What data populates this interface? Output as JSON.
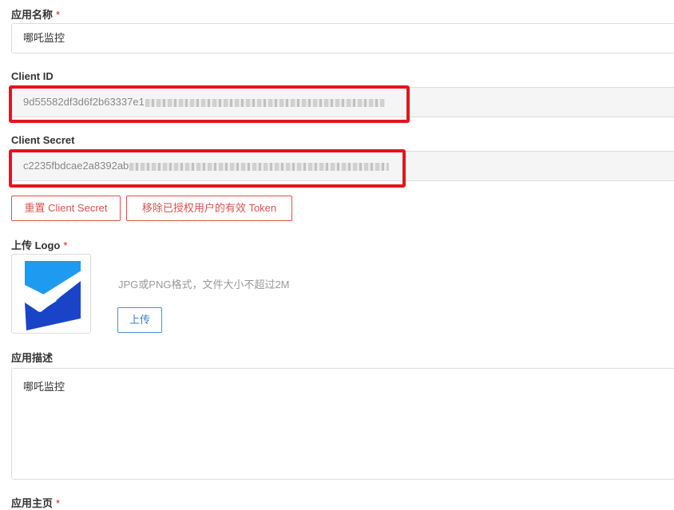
{
  "form": {
    "app_name": {
      "label": "应用名称",
      "required_mark": "*",
      "value": "哪吒监控"
    },
    "client_id": {
      "label": "Client ID",
      "visible_value": "9d55582df3d6f2b63337e1"
    },
    "client_secret": {
      "label": "Client Secret",
      "visible_value": "c2235fbdcae2a8392ab"
    },
    "buttons": {
      "reset_secret": "重置 Client Secret",
      "revoke_tokens": "移除已授权用户的有效 Token"
    },
    "logo": {
      "label": "上传 Logo",
      "required_mark": "*",
      "hint": "JPG或PNG格式，文件大小不超过2M",
      "upload_button": "上传"
    },
    "description": {
      "label": "应用描述",
      "value": "哪吒监控"
    },
    "homepage": {
      "label": "应用主页",
      "required_mark": "*"
    }
  },
  "colors": {
    "highlight": "#e8131c",
    "danger": "#d9534f",
    "primary": "#3a7fc4",
    "logo_light": "#1e9af0",
    "logo_dark": "#1a44c8"
  }
}
